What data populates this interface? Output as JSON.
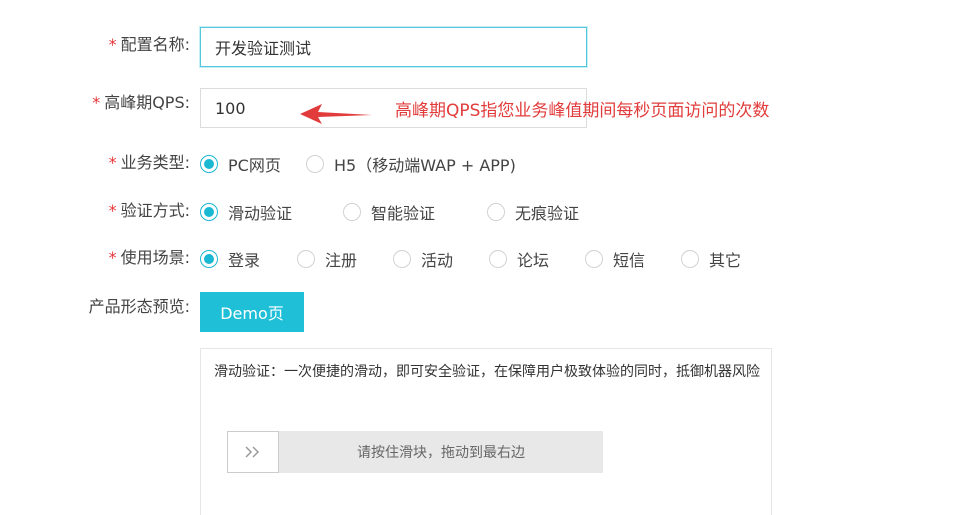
{
  "form": {
    "config_name": {
      "label": "配置名称:",
      "value": "开发验证测试"
    },
    "qps": {
      "label": "高峰期QPS:",
      "value": "100",
      "annotation": "高峰期QPS指您业务峰值期间每秒页面访问的次数",
      "annotation_color": "#e23b3b"
    },
    "business_type": {
      "label": "业务类型:",
      "options": [
        "PC网页",
        "H5（移动端WAP + APP)"
      ],
      "selected": "PC网页"
    },
    "verify_method": {
      "label": "验证方式:",
      "options": [
        "滑动验证",
        "智能验证",
        "无痕验证"
      ],
      "selected": "滑动验证"
    },
    "scene": {
      "label": "使用场景:",
      "options": [
        "登录",
        "注册",
        "活动",
        "论坛",
        "短信",
        "其它"
      ],
      "selected": "登录"
    },
    "preview": {
      "label": "产品形态预览:",
      "demo_button": "Demo页",
      "description": "滑动验证：一次便捷的滑动，即可安全验证，在保障用户极致体验的同时，抵御机器风险",
      "slider_text": "请按住滑块，拖动到最右边",
      "slider_handle_icon": "double-chevron-right-icon"
    },
    "required_mark": "*"
  },
  "colors": {
    "accent": "#1bb8d3",
    "button": "#1fbfd8",
    "required": "#e5353a"
  }
}
